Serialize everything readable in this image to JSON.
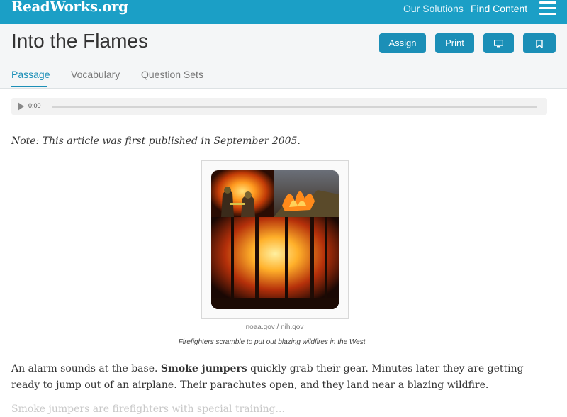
{
  "header": {
    "logo": "ReadWorks.org",
    "nav": [
      "Our Solutions",
      "Find Content"
    ]
  },
  "article": {
    "title": "Into the Flames",
    "buttons": {
      "assign": "Assign",
      "print": "Print"
    },
    "tabs": [
      "Passage",
      "Vocabulary",
      "Question Sets"
    ],
    "audio": {
      "time": "0:00"
    },
    "note": "Note: This article was first published in September 2005.",
    "image_credit": "noaa.gov / nih.gov",
    "caption": "Firefighters scramble to put out blazing wildfires in the West.",
    "para1": {
      "before": "An alarm sounds at the base. ",
      "bold": "Smoke jumpers",
      "after": " quickly grab their gear. Minutes later they are getting ready to jump out of an airplane. Their parachutes open, and they land near a blazing wildfire."
    },
    "para2": "Smoke jumpers are firefighters with special training..."
  },
  "colors": {
    "brand": "#1b9fc6",
    "button": "#1b8fb7"
  },
  "icons": [
    "menu-icon",
    "monitor-icon",
    "bookmark-icon",
    "play-icon"
  ]
}
